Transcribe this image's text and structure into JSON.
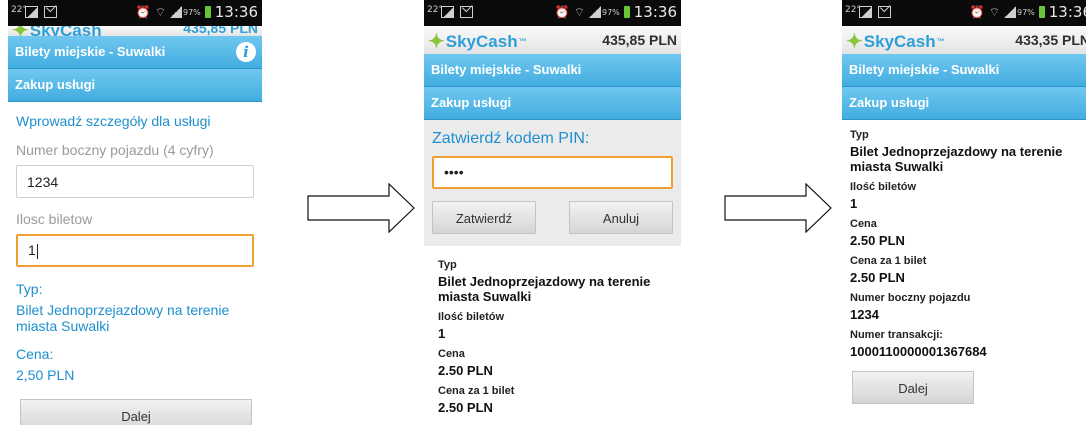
{
  "status": {
    "temp": "22°",
    "battery_pct": "97%",
    "time": "13:36"
  },
  "app": {
    "brand": "SkyCash",
    "tm": "™",
    "title": "Bilety miejskie - Suwalki",
    "subtitle": "Zakup usługi"
  },
  "screen1": {
    "balance": "435,85 PLN",
    "prompt": "Wprowadź szczegóły dla usługi",
    "vehicle_label": "Numer boczny pojazdu (4 cyfry)",
    "vehicle_value": "1234",
    "count_label": "Ilosc biletow",
    "count_value": "1",
    "type_label": "Typ:",
    "type_value": "Bilet Jednoprzejazdowy na terenie miasta Suwalki",
    "price_label": "Cena:",
    "price_value": "2,50 PLN",
    "next_button": "Dalej"
  },
  "screen2": {
    "balance": "435,85 PLN",
    "pin_label": "Zatwierdź kodem PIN:",
    "pin_value": "••••",
    "confirm_button": "Zatwierdź",
    "cancel_button": "Anuluj",
    "details": [
      {
        "k": "Typ",
        "v": "Bilet Jednoprzejazdowy na terenie miasta Suwalki"
      },
      {
        "k": "Ilość biletów",
        "v": "1"
      },
      {
        "k": "Cena",
        "v": "2.50 PLN"
      },
      {
        "k": "Cena za 1 bilet",
        "v": "2.50 PLN"
      }
    ]
  },
  "screen3": {
    "balance": "433,35 PLN",
    "details": [
      {
        "k": "Typ",
        "v": "Bilet Jednoprzejazdowy na terenie miasta Suwalki"
      },
      {
        "k": "Ilość biletów",
        "v": "1"
      },
      {
        "k": "Cena",
        "v": "2.50 PLN"
      },
      {
        "k": "Cena za 1 bilet",
        "v": "2.50 PLN"
      },
      {
        "k": "Numer boczny pojazdu",
        "v": "1234"
      },
      {
        "k": "Numer transakcji:",
        "v": "1000110000001367684"
      }
    ],
    "next_button": "Dalej"
  },
  "colors": {
    "accent": "#42ade0",
    "link": "#1e8fcf",
    "focus": "#f0a030",
    "logo_star": "#8cc63e"
  },
  "icons": [
    "picture-icon",
    "mail-icon",
    "alarm-icon",
    "wifi-icon",
    "signal-icon",
    "battery-icon",
    "info-icon",
    "right-arrow-icon"
  ]
}
